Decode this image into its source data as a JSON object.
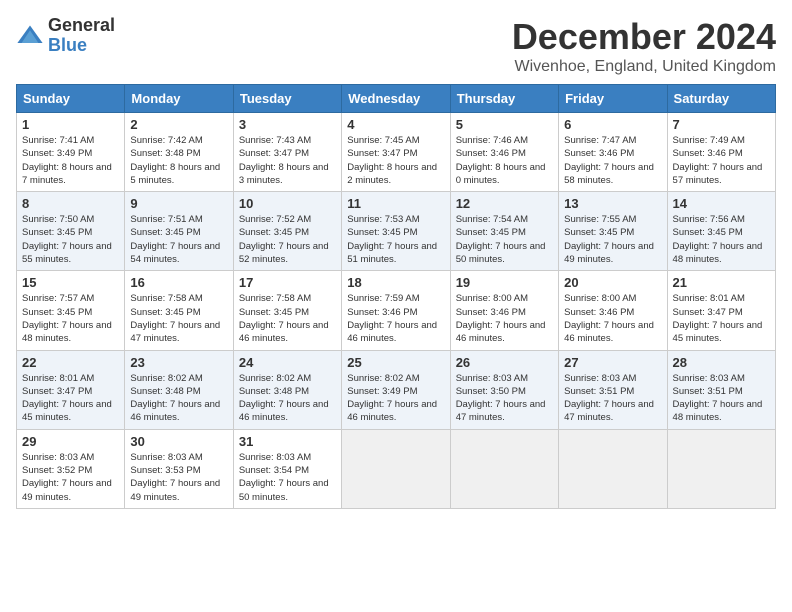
{
  "header": {
    "logo_general": "General",
    "logo_blue": "Blue",
    "month_title": "December 2024",
    "location": "Wivenhoe, England, United Kingdom"
  },
  "columns": [
    "Sunday",
    "Monday",
    "Tuesday",
    "Wednesday",
    "Thursday",
    "Friday",
    "Saturday"
  ],
  "weeks": [
    [
      {
        "day": "1",
        "sunrise": "Sunrise: 7:41 AM",
        "sunset": "Sunset: 3:49 PM",
        "daylight": "Daylight: 8 hours and 7 minutes."
      },
      {
        "day": "2",
        "sunrise": "Sunrise: 7:42 AM",
        "sunset": "Sunset: 3:48 PM",
        "daylight": "Daylight: 8 hours and 5 minutes."
      },
      {
        "day": "3",
        "sunrise": "Sunrise: 7:43 AM",
        "sunset": "Sunset: 3:47 PM",
        "daylight": "Daylight: 8 hours and 3 minutes."
      },
      {
        "day": "4",
        "sunrise": "Sunrise: 7:45 AM",
        "sunset": "Sunset: 3:47 PM",
        "daylight": "Daylight: 8 hours and 2 minutes."
      },
      {
        "day": "5",
        "sunrise": "Sunrise: 7:46 AM",
        "sunset": "Sunset: 3:46 PM",
        "daylight": "Daylight: 8 hours and 0 minutes."
      },
      {
        "day": "6",
        "sunrise": "Sunrise: 7:47 AM",
        "sunset": "Sunset: 3:46 PM",
        "daylight": "Daylight: 7 hours and 58 minutes."
      },
      {
        "day": "7",
        "sunrise": "Sunrise: 7:49 AM",
        "sunset": "Sunset: 3:46 PM",
        "daylight": "Daylight: 7 hours and 57 minutes."
      }
    ],
    [
      {
        "day": "8",
        "sunrise": "Sunrise: 7:50 AM",
        "sunset": "Sunset: 3:45 PM",
        "daylight": "Daylight: 7 hours and 55 minutes."
      },
      {
        "day": "9",
        "sunrise": "Sunrise: 7:51 AM",
        "sunset": "Sunset: 3:45 PM",
        "daylight": "Daylight: 7 hours and 54 minutes."
      },
      {
        "day": "10",
        "sunrise": "Sunrise: 7:52 AM",
        "sunset": "Sunset: 3:45 PM",
        "daylight": "Daylight: 7 hours and 52 minutes."
      },
      {
        "day": "11",
        "sunrise": "Sunrise: 7:53 AM",
        "sunset": "Sunset: 3:45 PM",
        "daylight": "Daylight: 7 hours and 51 minutes."
      },
      {
        "day": "12",
        "sunrise": "Sunrise: 7:54 AM",
        "sunset": "Sunset: 3:45 PM",
        "daylight": "Daylight: 7 hours and 50 minutes."
      },
      {
        "day": "13",
        "sunrise": "Sunrise: 7:55 AM",
        "sunset": "Sunset: 3:45 PM",
        "daylight": "Daylight: 7 hours and 49 minutes."
      },
      {
        "day": "14",
        "sunrise": "Sunrise: 7:56 AM",
        "sunset": "Sunset: 3:45 PM",
        "daylight": "Daylight: 7 hours and 48 minutes."
      }
    ],
    [
      {
        "day": "15",
        "sunrise": "Sunrise: 7:57 AM",
        "sunset": "Sunset: 3:45 PM",
        "daylight": "Daylight: 7 hours and 48 minutes."
      },
      {
        "day": "16",
        "sunrise": "Sunrise: 7:58 AM",
        "sunset": "Sunset: 3:45 PM",
        "daylight": "Daylight: 7 hours and 47 minutes."
      },
      {
        "day": "17",
        "sunrise": "Sunrise: 7:58 AM",
        "sunset": "Sunset: 3:45 PM",
        "daylight": "Daylight: 7 hours and 46 minutes."
      },
      {
        "day": "18",
        "sunrise": "Sunrise: 7:59 AM",
        "sunset": "Sunset: 3:46 PM",
        "daylight": "Daylight: 7 hours and 46 minutes."
      },
      {
        "day": "19",
        "sunrise": "Sunrise: 8:00 AM",
        "sunset": "Sunset: 3:46 PM",
        "daylight": "Daylight: 7 hours and 46 minutes."
      },
      {
        "day": "20",
        "sunrise": "Sunrise: 8:00 AM",
        "sunset": "Sunset: 3:46 PM",
        "daylight": "Daylight: 7 hours and 46 minutes."
      },
      {
        "day": "21",
        "sunrise": "Sunrise: 8:01 AM",
        "sunset": "Sunset: 3:47 PM",
        "daylight": "Daylight: 7 hours and 45 minutes."
      }
    ],
    [
      {
        "day": "22",
        "sunrise": "Sunrise: 8:01 AM",
        "sunset": "Sunset: 3:47 PM",
        "daylight": "Daylight: 7 hours and 45 minutes."
      },
      {
        "day": "23",
        "sunrise": "Sunrise: 8:02 AM",
        "sunset": "Sunset: 3:48 PM",
        "daylight": "Daylight: 7 hours and 46 minutes."
      },
      {
        "day": "24",
        "sunrise": "Sunrise: 8:02 AM",
        "sunset": "Sunset: 3:48 PM",
        "daylight": "Daylight: 7 hours and 46 minutes."
      },
      {
        "day": "25",
        "sunrise": "Sunrise: 8:02 AM",
        "sunset": "Sunset: 3:49 PM",
        "daylight": "Daylight: 7 hours and 46 minutes."
      },
      {
        "day": "26",
        "sunrise": "Sunrise: 8:03 AM",
        "sunset": "Sunset: 3:50 PM",
        "daylight": "Daylight: 7 hours and 47 minutes."
      },
      {
        "day": "27",
        "sunrise": "Sunrise: 8:03 AM",
        "sunset": "Sunset: 3:51 PM",
        "daylight": "Daylight: 7 hours and 47 minutes."
      },
      {
        "day": "28",
        "sunrise": "Sunrise: 8:03 AM",
        "sunset": "Sunset: 3:51 PM",
        "daylight": "Daylight: 7 hours and 48 minutes."
      }
    ],
    [
      {
        "day": "29",
        "sunrise": "Sunrise: 8:03 AM",
        "sunset": "Sunset: 3:52 PM",
        "daylight": "Daylight: 7 hours and 49 minutes."
      },
      {
        "day": "30",
        "sunrise": "Sunrise: 8:03 AM",
        "sunset": "Sunset: 3:53 PM",
        "daylight": "Daylight: 7 hours and 49 minutes."
      },
      {
        "day": "31",
        "sunrise": "Sunrise: 8:03 AM",
        "sunset": "Sunset: 3:54 PM",
        "daylight": "Daylight: 7 hours and 50 minutes."
      },
      null,
      null,
      null,
      null
    ]
  ]
}
